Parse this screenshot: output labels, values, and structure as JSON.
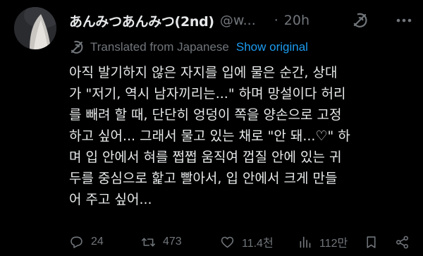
{
  "tweet": {
    "author_name": "あんみつあんみつ(2nd)",
    "author_handle": "@w...",
    "separator": "·",
    "time": "20h",
    "translated_label": "Translated from Japanese",
    "show_original_label": "Show original",
    "body_lines": [
      "아직 발기하지 않은 자지를 입에 물은 순간, 상대",
      "가 \"저기, 역시 남자끼리는...\" 하며 망설이다 허리",
      "를 빼려 할 때, 단단히 엉덩이 쪽을 양손으로 고정",
      "하고 싶어... 그래서 물고 있는 채로 \"안 돼...♡\" 하",
      "며 입 안에서 혀를 쩝쩝 움직여 껍질 안에 있는 귀",
      "두를 중심으로 핥고 빨아서, 입 안에서 크게 만들",
      "어 주고 싶어..."
    ],
    "metrics": {
      "replies": "24",
      "retweets": "473",
      "likes": "11.4천",
      "views": "112만"
    },
    "icons": {
      "avatar": "avatar",
      "grok": "grok-icon",
      "more": "more-icon",
      "translate": "translate-icon",
      "reply": "reply-icon",
      "retweet": "retweet-icon",
      "like": "heart-icon",
      "views": "views-icon",
      "bookmark": "bookmark-icon",
      "share": "share-icon"
    },
    "colors": {
      "background": "#000000",
      "text": "#e7e9ea",
      "muted": "#71767b",
      "link": "#1d9bf0"
    }
  }
}
